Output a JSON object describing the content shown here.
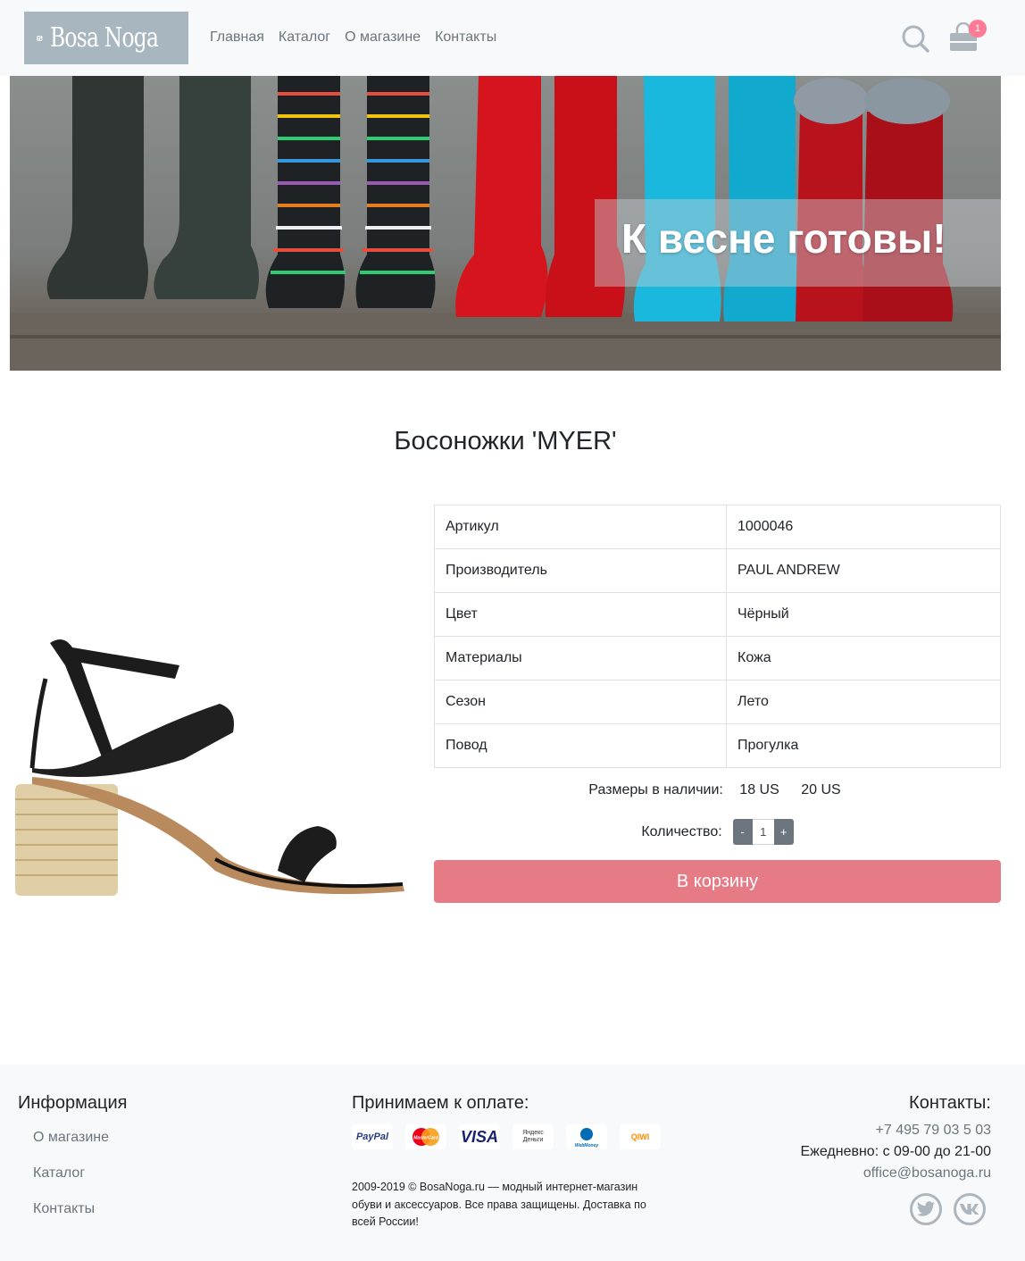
{
  "header": {
    "logo_text": "Bosa Noga",
    "nav": [
      "Главная",
      "Каталог",
      "О магазине",
      "Контакты"
    ],
    "cart_count": "1"
  },
  "banner": {
    "title": "К весне готовы!"
  },
  "product": {
    "title": "Босоножки 'MYER'",
    "properties": [
      {
        "label": "Артикул",
        "value": "1000046"
      },
      {
        "label": "Производитель",
        "value": "PAUL ANDREW"
      },
      {
        "label": "Цвет",
        "value": "Чёрный"
      },
      {
        "label": "Материалы",
        "value": "Кожа"
      },
      {
        "label": "Сезон",
        "value": "Лето"
      },
      {
        "label": "Повод",
        "value": "Прогулка"
      }
    ],
    "sizes_label": "Размеры в наличии:",
    "sizes": [
      "18 US",
      "20 US"
    ],
    "quantity_label": "Количество:",
    "quantity": "1",
    "minus": "-",
    "plus": "+",
    "cart_button": "В корзину"
  },
  "footer": {
    "info_heading": "Информация",
    "info_links": [
      "О магазине",
      "Каталог",
      "Контакты"
    ],
    "payment_heading": "Принимаем к оплате:",
    "payment_methods": [
      "PayPal",
      "MasterCard",
      "VISA",
      "Яндекс Деньги",
      "WebMoney",
      "QIWI"
    ],
    "copyright": "2009-2019 © BosaNoga.ru — модный интернет-магазин обуви и аксессуаров. Все права защищены. Доставка по всей России!",
    "contacts_heading": "Контакты:",
    "phone": "+7 495 79 03 5 03",
    "hours": "Ежедневно: с 09-00 до 21-00",
    "email": "office@bosanoga.ru",
    "social": [
      "twitter-icon",
      "vk-icon"
    ]
  }
}
